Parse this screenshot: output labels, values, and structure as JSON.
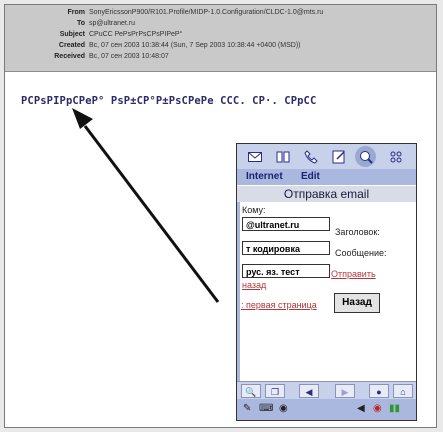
{
  "header": {
    "rows": [
      {
        "label": "From",
        "value": "SonyEricssonP900/R101.Profile/MIDP-1.0.Configuration/CLDC-1.0@mts.ru"
      },
      {
        "label": "To",
        "value": "sp@ultranet.ru"
      },
      {
        "label": "Subject",
        "value": "СРuСС РеРsРгРsСPsPIPeP°"
      },
      {
        "label": "Created",
        "value": "Вс, 07 сен 2003 10:38:44 (Sun, 7 Sep 2003 10:38:44 +0400 (MSD))"
      },
      {
        "label": "Received",
        "value": "Вс, 07 сен 2003 10:48:07"
      }
    ]
  },
  "message": {
    "body": "PCPsPIPpCPeP° PsP±CP°P±PsCPePe CCC. CP·. CPpCC"
  },
  "phone": {
    "toolbar_icons": [
      "envelope-icon",
      "book-icon",
      "phone-icon",
      "notes-icon",
      "browser-icon",
      "grid-icon"
    ],
    "menu": {
      "internet": "Internet",
      "edit": "Edit"
    },
    "title": "Отправка email",
    "to_label": "Кому:",
    "to_value": "@ultranet.ru",
    "subject_label": "Заголовок:",
    "subject_value": "т кодировка",
    "message_label": "Сообщение:",
    "message_value": "рус. яз. тест",
    "send_link": "Отправить",
    "back_link": "назад",
    "first_page_link": ": первая страница",
    "back_button": "Назад",
    "bottom_toolbar": [
      "find",
      "copy",
      "back",
      "forward",
      "stop",
      "home"
    ],
    "status": [
      "pen-icon",
      "keyboard-icon",
      "globe-icon",
      "volume-icon",
      "connection-icon",
      "battery-icon"
    ]
  },
  "colors": {
    "header_bg": "#c9c9c9",
    "link": "#b2373b",
    "phone_accent": "#aab7df"
  }
}
